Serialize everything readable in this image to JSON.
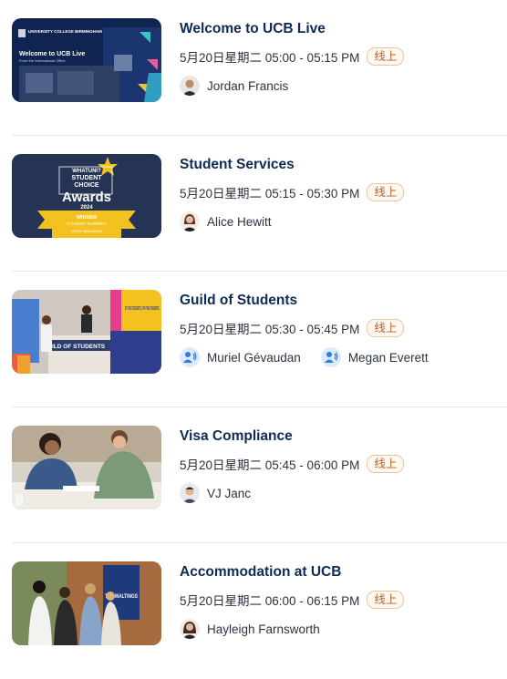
{
  "sessions": [
    {
      "title": "Welcome to UCB Live",
      "time": "5月20日星期二 05:00 - 05:15 PM",
      "badge": "线上",
      "thumb": {
        "logo": "UNIVERSITY COLLEGE BIRMINGHAM",
        "headline": "Welcome to UCB Live",
        "sub": "From the International Office"
      },
      "speakers": [
        {
          "name": "Jordan Francis",
          "avatar": "photo"
        }
      ]
    },
    {
      "title": "Student Services",
      "time": "5月20日星期二 05:15 - 05:30 PM",
      "badge": "线上",
      "thumb": {
        "top": "WHATUNI?",
        "line2": "STUDENT",
        "line3": "CHOICE",
        "big": "Awards",
        "year": "2024",
        "banner1": "WINNER",
        "banner2": "STUDENT SUPPORT",
        "banner3": "WEST MIDLANDS"
      },
      "speakers": [
        {
          "name": "Alice Hewitt",
          "avatar": "photo"
        }
      ]
    },
    {
      "title": "Guild of Students",
      "time": "5月20日星期二 05:30 - 05:45 PM",
      "badge": "线上",
      "thumb": {
        "sign": "ILD OF STUDENTS",
        "poster": "BY THE STUDENTS, FOR THE STUDENTS."
      },
      "speakers": [
        {
          "name": "Muriel Gévaudan",
          "avatar": "generic"
        },
        {
          "name": "Megan Everett",
          "avatar": "generic"
        }
      ]
    },
    {
      "title": "Visa Compliance",
      "time": "5月20日星期二 05:45 - 06:00 PM",
      "badge": "线上",
      "thumb": {},
      "speakers": [
        {
          "name": "VJ Janc",
          "avatar": "photo"
        }
      ]
    },
    {
      "title": "Accommodation at UCB",
      "time": "5月20日星期二 06:00 - 06:15 PM",
      "badge": "线上",
      "thumb": {
        "sign": "THE MALTINGS"
      },
      "speakers": [
        {
          "name": "Hayleigh Farnsworth",
          "avatar": "photo"
        }
      ]
    }
  ]
}
